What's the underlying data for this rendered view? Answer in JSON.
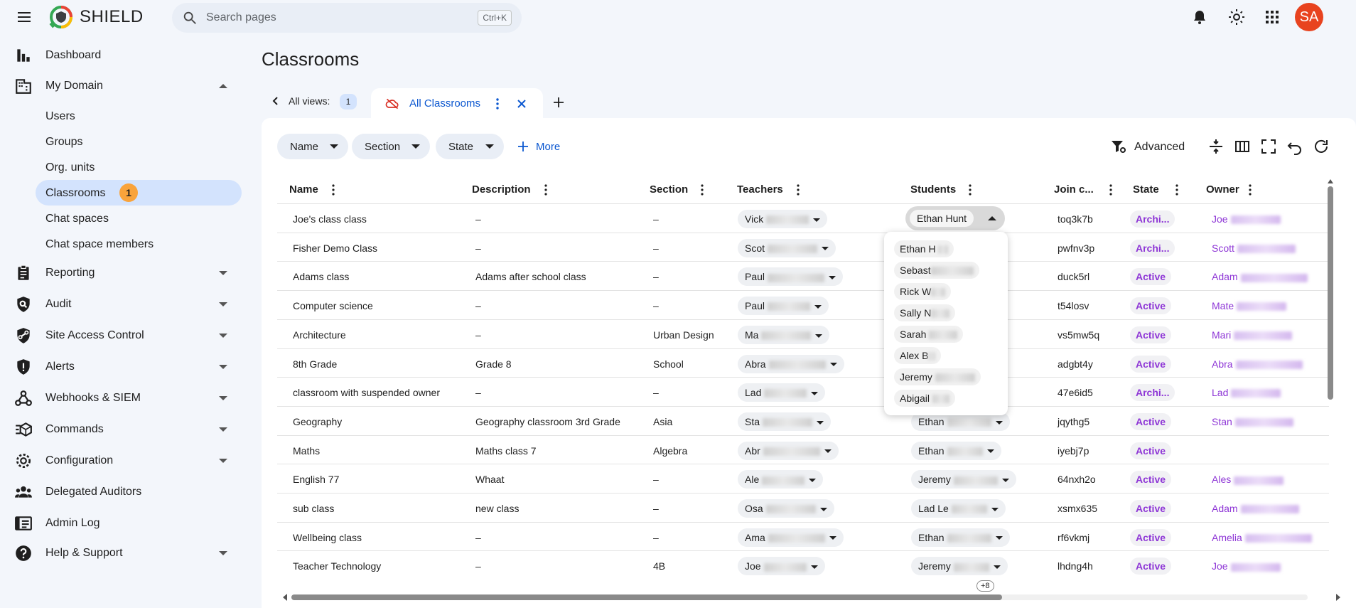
{
  "app": {
    "brand": "SHIELD",
    "avatar_initials": "SA",
    "accent_color": "#0b57d0",
    "avatar_color": "#e8431f"
  },
  "search": {
    "placeholder": "Search pages",
    "shortcut": "Ctrl+K"
  },
  "top_icons": [
    "notifications-icon",
    "theme-toggle-icon",
    "apps-grid-icon"
  ],
  "sidebar": {
    "items": [
      {
        "label": "Dashboard",
        "icon": "bar-chart-icon"
      },
      {
        "label": "My Domain",
        "icon": "building-icon",
        "expanded": true,
        "children": [
          {
            "label": "Users"
          },
          {
            "label": "Groups"
          },
          {
            "label": "Org. units"
          },
          {
            "label": "Classrooms",
            "active": true,
            "badge": "1"
          },
          {
            "label": "Chat spaces"
          },
          {
            "label": "Chat space members"
          }
        ]
      },
      {
        "label": "Reporting",
        "icon": "clipboard-icon"
      },
      {
        "label": "Audit",
        "icon": "audit-search-icon"
      },
      {
        "label": "Site Access Control",
        "icon": "link-shield-icon"
      },
      {
        "label": "Alerts",
        "icon": "alert-shield-icon"
      },
      {
        "label": "Webhooks & SIEM",
        "icon": "webhook-icon"
      },
      {
        "label": "Commands",
        "icon": "commands-icon"
      },
      {
        "label": "Configuration",
        "icon": "gear-icon"
      },
      {
        "label": "Delegated Auditors",
        "icon": "people-icon"
      },
      {
        "label": "Admin Log",
        "icon": "log-icon"
      },
      {
        "label": "Help & Support",
        "icon": "help-icon"
      }
    ]
  },
  "main": {
    "title": "Classrooms",
    "views": {
      "label": "All views:",
      "count": "1"
    },
    "active_tab": "All Classrooms",
    "filters": [
      "Name",
      "Section",
      "State"
    ],
    "more_label": "More",
    "advanced_label": "Advanced",
    "columns": [
      "Name",
      "Description",
      "Section",
      "Teachers",
      "Students",
      "Join c...",
      "State",
      "Owner"
    ],
    "rows": [
      {
        "name": "Joe's class class",
        "description": "–",
        "section": "–",
        "teacher": "Vick",
        "student": "Ethan Hunt",
        "join": "toq3k7b",
        "state": "Archi...",
        "owner": "Joe"
      },
      {
        "name": "Fisher Demo Class",
        "description": "–",
        "section": "–",
        "teacher": "Scot",
        "student": "",
        "join": "pwfnv3p",
        "state": "Archi...",
        "owner": "Scott"
      },
      {
        "name": "Adams class",
        "description": "Adams after school class",
        "section": "–",
        "teacher": "Paul",
        "student": "",
        "join": "duck5rl",
        "state": "Active",
        "owner": "Adam"
      },
      {
        "name": "Computer science",
        "description": "–",
        "section": "–",
        "teacher": "Paul",
        "student": "",
        "join": "t54losv",
        "state": "Active",
        "owner": "Mate"
      },
      {
        "name": "Architecture",
        "description": "–",
        "section": "Urban Design",
        "teacher": "Ma",
        "student": "",
        "join": "vs5mw5q",
        "state": "Active",
        "owner": "Mari"
      },
      {
        "name": "8th Grade",
        "description": "Grade 8",
        "section": "School",
        "teacher": "Abra",
        "student": "",
        "join": "adgbt4y",
        "state": "Active",
        "owner": "Abra"
      },
      {
        "name": "classroom with suspended owner",
        "description": "–",
        "section": "–",
        "teacher": "Lad",
        "student": "",
        "join": "47e6id5",
        "state": "Archi...",
        "owner": "Lad"
      },
      {
        "name": "Geography",
        "description": "Geography classroom 3rd Grade",
        "section": "Asia",
        "teacher": "Sta",
        "student": "Ethan",
        "join": "jqythg5",
        "state": "Active",
        "owner": "Stan"
      },
      {
        "name": "Maths",
        "description": "Maths class 7",
        "section": "Algebra",
        "teacher": "Abr",
        "student": "Ethan",
        "join": "iyebj7p",
        "state": "Active",
        "owner": ""
      },
      {
        "name": "English 77",
        "description": "Whaat",
        "section": "–",
        "teacher": "Ale",
        "student": "Jeremy",
        "join": "64nxh2o",
        "state": "Active",
        "owner": "Ales"
      },
      {
        "name": "sub class",
        "description": "new class",
        "section": "–",
        "teacher": "Osa",
        "student": "Lad Le",
        "join": "xsmx635",
        "state": "Active",
        "owner": "Adam"
      },
      {
        "name": "Wellbeing class",
        "description": "–",
        "section": "–",
        "teacher": "Ama",
        "student": "Ethan",
        "join": "rf6vkmj",
        "state": "Active",
        "owner": "Amelia"
      },
      {
        "name": "Teacher Technology",
        "description": "–",
        "section": "4B",
        "teacher": "Joe",
        "student": "Jeremy",
        "join": "lhdng4h",
        "state": "Active",
        "owner": "Joe"
      }
    ],
    "students_dropdown": [
      "Ethan H",
      "Sebast",
      "Rick W",
      "Sally N",
      "Sarah",
      "Alex B",
      "Jeremy",
      "Abigail"
    ],
    "more_students_badge": "+8"
  }
}
